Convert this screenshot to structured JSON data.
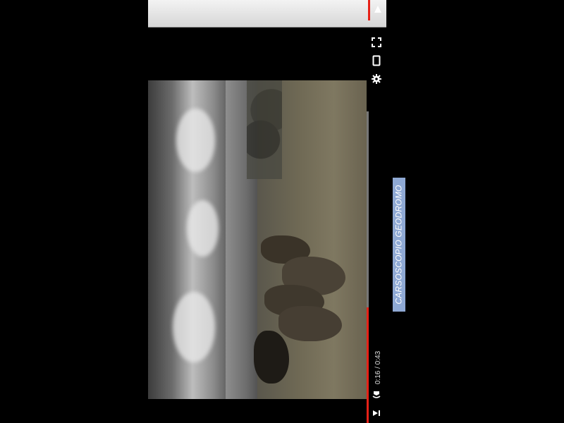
{
  "player": {
    "time_display": "0:16 / 0:43",
    "progress_fraction": 0.37,
    "accent_color": "#e62117"
  },
  "caption": {
    "text": "CARSOSCOPIO GEODROMO"
  },
  "icons": {
    "mini_play": "play-triangle-icon",
    "fullscreen": "fullscreen-icon",
    "device": "device-icon",
    "settings": "gear-icon",
    "volume": "volume-icon",
    "next": "skip-next-icon"
  }
}
